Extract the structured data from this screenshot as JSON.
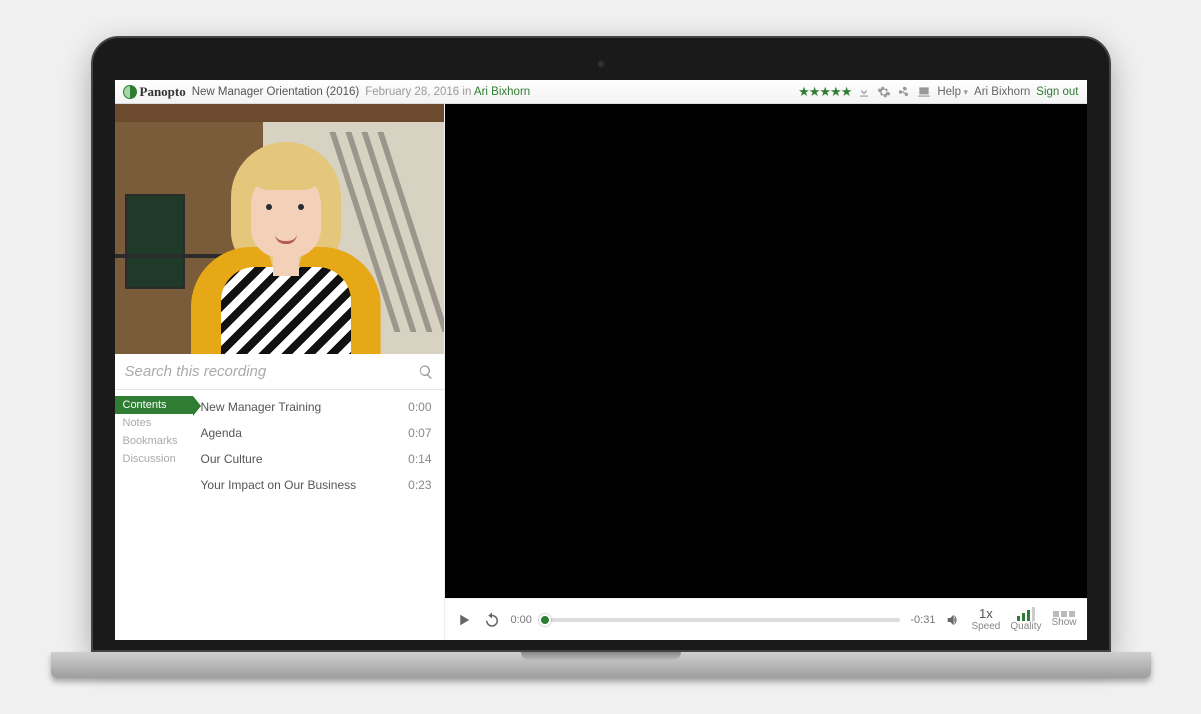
{
  "header": {
    "brand": "Panopto",
    "title": "New Manager Orientation (2016)",
    "date": "February 28, 2016",
    "in_word": "in",
    "author": "Ari Bixhorn",
    "rating": 5,
    "help_label": "Help",
    "user_name": "Ari Bixhorn",
    "signout_label": "Sign out"
  },
  "search": {
    "placeholder": "Search this recording"
  },
  "tabs": {
    "contents": "Contents",
    "notes": "Notes",
    "bookmarks": "Bookmarks",
    "discussion": "Discussion",
    "active": "contents"
  },
  "toc": [
    {
      "title": "New Manager Training",
      "time": "0:00"
    },
    {
      "title": "Agenda",
      "time": "0:07"
    },
    {
      "title": "Our Culture",
      "time": "0:14"
    },
    {
      "title": "Your Impact on Our Business",
      "time": "0:23"
    }
  ],
  "player": {
    "current_time": "0:00",
    "remaining_time": "-0:31",
    "speed_value": "1x",
    "speed_label": "Speed",
    "quality_label": "Quality",
    "show_label": "Show"
  }
}
